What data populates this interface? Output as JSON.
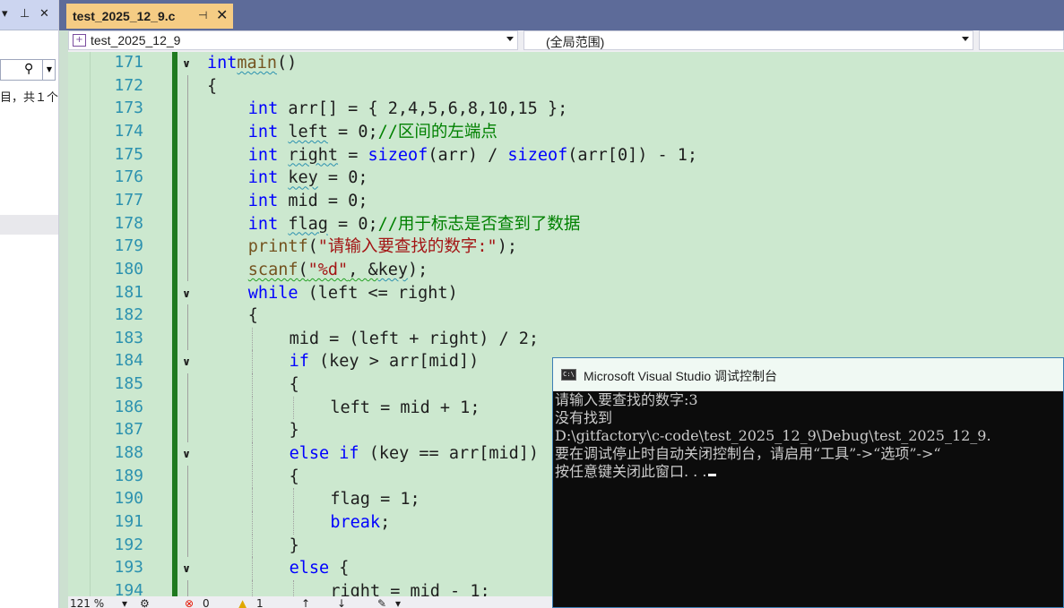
{
  "left_panel": {
    "header_icons": [
      "dropdown-icon",
      "pin-icon",
      "close-icon"
    ],
    "search_icon": "search-icon",
    "summary_text": "目，共１个"
  },
  "tab": {
    "title": "test_2025_12_9.c",
    "pin_glyph": "⊣",
    "close_glyph": "✕"
  },
  "nav": {
    "project": "test_2025_12_9",
    "scope": "(全局范围)"
  },
  "editor": {
    "lines": [
      {
        "n": "171",
        "fold": true
      },
      {
        "n": "172",
        "fold": false
      },
      {
        "n": "173",
        "fold": false
      },
      {
        "n": "174",
        "fold": false
      },
      {
        "n": "175",
        "fold": false
      },
      {
        "n": "176",
        "fold": false
      },
      {
        "n": "177",
        "fold": false
      },
      {
        "n": "178",
        "fold": false
      },
      {
        "n": "179",
        "fold": false
      },
      {
        "n": "180",
        "fold": false
      },
      {
        "n": "181",
        "fold": true
      },
      {
        "n": "182",
        "fold": false
      },
      {
        "n": "183",
        "fold": false
      },
      {
        "n": "184",
        "fold": true
      },
      {
        "n": "185",
        "fold": false
      },
      {
        "n": "186",
        "fold": false
      },
      {
        "n": "187",
        "fold": false
      },
      {
        "n": "188",
        "fold": true
      },
      {
        "n": "189",
        "fold": false
      },
      {
        "n": "190",
        "fold": false
      },
      {
        "n": "191",
        "fold": false
      },
      {
        "n": "192",
        "fold": false
      },
      {
        "n": "193",
        "fold": true
      },
      {
        "n": "194",
        "fold": false
      }
    ],
    "code": {
      "l171_kw": "int",
      "l171_fn": "main",
      "l171_rest": "()",
      "l172": "{",
      "l173_kw": "int",
      "l173_rest": " arr[] = { 2,4,5,6,8,10,15 };",
      "l174_kw": "int",
      "l174_var": "left",
      "l174_rest": " = 0;",
      "l174_cm": "//区间的左端点",
      "l175_kw": "int",
      "l175_var": "right",
      "l175_a": " = ",
      "l175_sz1": "sizeof",
      "l175_b": "(arr) / ",
      "l175_sz2": "sizeof",
      "l175_c": "(arr[0]) - 1;",
      "l176_kw": "int",
      "l176_var": "key",
      "l176_rest": " = 0;",
      "l177_kw": "int",
      "l177_rest": " mid = 0;",
      "l178_kw": "int",
      "l178_var": "flag",
      "l178_rest": " = 0;",
      "l178_cm": "//用于标志是否查到了数据",
      "l179_fn": "printf",
      "l179_a": "(",
      "l179_str": "\"请输入要查找的数字:\"",
      "l179_b": ");",
      "l180_fn": "scanf",
      "l180_a": "(",
      "l180_str": "\"%d\"",
      "l180_b": ", &",
      "l180_var": "key",
      "l180_c": ");",
      "l181_kw": "while",
      "l181_rest": " (left <= right)",
      "l182": "{",
      "l183": "mid = (left + right) / 2;",
      "l184_kw": "if",
      "l184_rest": " (key > arr[mid])",
      "l185": "{",
      "l186": "left = mid + 1;",
      "l187": "}",
      "l188_kw1": "else",
      "l188_kw2": "if",
      "l188_rest": " (key == arr[mid])",
      "l189": "{",
      "l190": "flag = 1;",
      "l191_kw": "break",
      "l191_rest": ";",
      "l192": "}",
      "l193_kw": "else",
      "l193_rest": " {",
      "l194": "right = mid - 1;"
    }
  },
  "status": {
    "zoom": "121 %",
    "errors": "0",
    "warnings": "1"
  },
  "console": {
    "title": "Microsoft Visual Studio 调试控制台",
    "icon_label": "C:\\",
    "lines": [
      "请输入要查找的数字:3",
      "没有找到",
      "D:\\gitfactory\\c-code\\test_2025_12_9\\Debug\\test_2025_12_9.",
      "要在调试停止时自动关闭控制台，请启用“工具”->“选项”->“",
      "按任意键关闭此窗口. . ."
    ]
  },
  "colors": {
    "editor_bg": "#CCE8CF",
    "tab_active": "#F5CC84",
    "tab_bar": "#5D6B99",
    "keyword": "#0000FF",
    "comment": "#008000",
    "string": "#A31515",
    "line_number": "#2B91AF",
    "change_bar": "#1F7A1F"
  }
}
